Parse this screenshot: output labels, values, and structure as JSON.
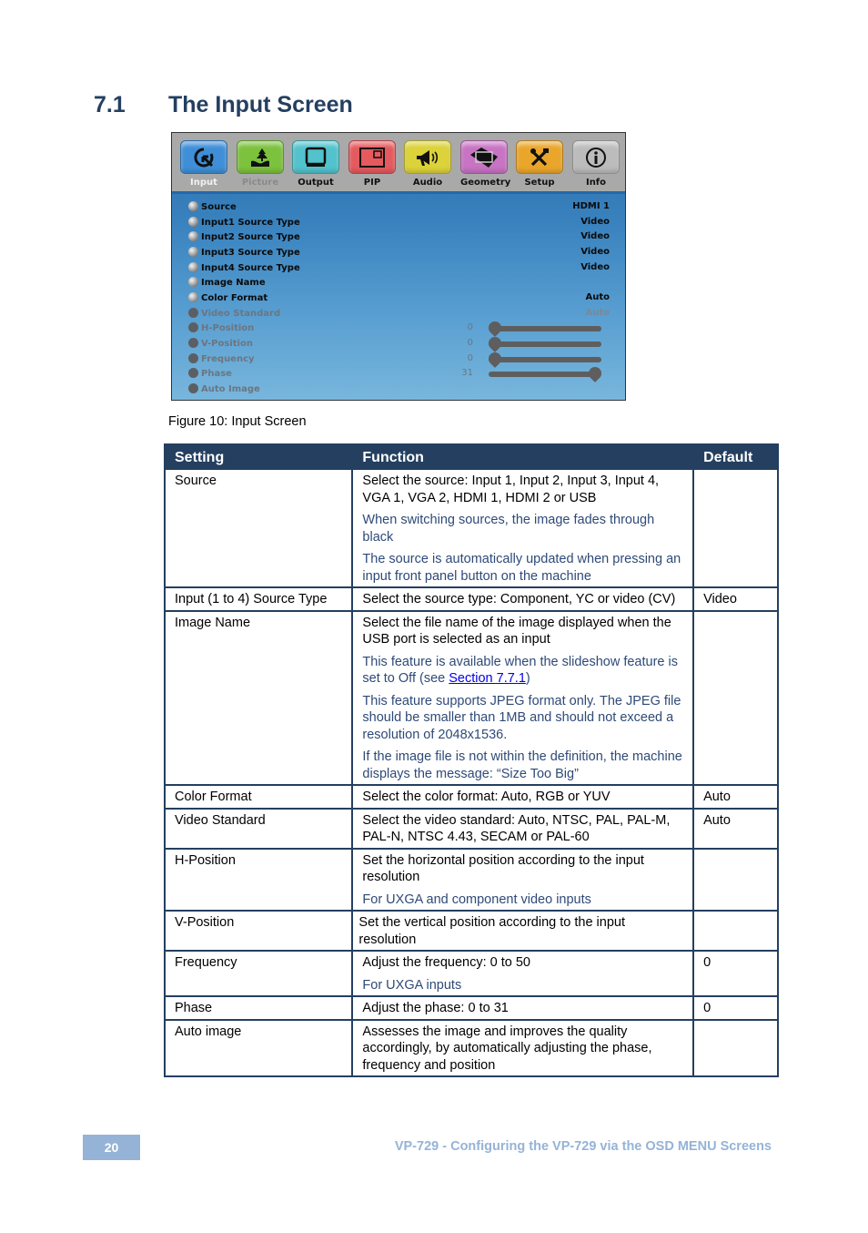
{
  "section": {
    "number": "7.1",
    "title": "The Input Screen"
  },
  "osd": {
    "tabs": [
      {
        "label": "Input",
        "icon": "input-cursor-icon",
        "color": "#3f8fd8",
        "state": "active"
      },
      {
        "label": "Picture",
        "icon": "picture-landscape-icon",
        "color": "#7cc23d",
        "state": "dim"
      },
      {
        "label": "Output",
        "icon": "output-monitor-icon",
        "color": "#52c3cc",
        "state": "normal"
      },
      {
        "label": "PIP",
        "icon": "pip-window-icon",
        "color": "#e55a5e",
        "state": "normal"
      },
      {
        "label": "Audio",
        "icon": "audio-speaker-icon",
        "color": "#dcd23a",
        "state": "normal"
      },
      {
        "label": "Geometry",
        "icon": "geometry-rectangle-icon",
        "color": "#c873c4",
        "state": "normal"
      },
      {
        "label": "Setup",
        "icon": "setup-tools-icon",
        "color": "#eaa62b",
        "state": "normal"
      },
      {
        "label": "Info",
        "icon": "info-icon",
        "color": "#bcbcbc",
        "state": "normal"
      }
    ],
    "items": [
      {
        "label": "Source",
        "value": "HDMI 1",
        "enabled": true
      },
      {
        "label": "Input1 Source Type",
        "value": "Video",
        "enabled": true
      },
      {
        "label": "Input2 Source Type",
        "value": "Video",
        "enabled": true
      },
      {
        "label": "Input3 Source Type",
        "value": "Video",
        "enabled": true
      },
      {
        "label": "Input4 Source Type",
        "value": "Video",
        "enabled": true
      },
      {
        "label": "Image Name",
        "value": "",
        "enabled": true
      },
      {
        "label": "Color Format",
        "value": "Auto",
        "enabled": true
      },
      {
        "label": "Video Standard",
        "value": "Auto",
        "enabled": false
      },
      {
        "label": "H-Position",
        "value": "0",
        "enabled": false,
        "slider": {
          "value": 0,
          "min": 0,
          "max": 31
        }
      },
      {
        "label": "V-Position",
        "value": "0",
        "enabled": false,
        "slider": {
          "value": 0,
          "min": 0,
          "max": 31
        }
      },
      {
        "label": "Frequency",
        "value": "0",
        "enabled": false,
        "slider": {
          "value": 0,
          "min": 0,
          "max": 31
        }
      },
      {
        "label": "Phase",
        "value": "31",
        "enabled": false,
        "slider": {
          "value": 31,
          "min": 0,
          "max": 31
        }
      },
      {
        "label": "Auto Image",
        "value": "",
        "enabled": false
      }
    ]
  },
  "caption": "Figure 10: Input Screen",
  "table": {
    "headers": [
      "Setting",
      "Function",
      "Default"
    ],
    "rows": [
      {
        "setting": "Source",
        "function": "Select the source: Input 1, Input 2, Input 3, Input 4, VGA 1, VGA 2, HDMI 1, HDMI 2 or USB",
        "notes": [
          "When switching sources, the image fades through black",
          "The source is automatically updated when pressing an input front panel button on the machine"
        ],
        "default": ""
      },
      {
        "setting": "Input (1 to 4) Source Type",
        "function": "Select the source type: Component, YC or video (CV)",
        "notes": [],
        "default": "Video"
      },
      {
        "setting": "Image Name",
        "function": "Select the file name of the image displayed when the USB port is selected as an input",
        "notes": [
          "This feature is available when the slideshow feature is set to Off (see ",
          "This feature supports JPEG format only. The JPEG file should be smaller than 1MB and should not exceed a resolution of 2048x1536.",
          "If the image file is not within the definition, the machine displays the message: “Size Too Big”"
        ],
        "link": {
          "text": "Section 7.7.1",
          "after": ")"
        },
        "default": ""
      },
      {
        "setting": "Color Format",
        "function": "Select the color format: Auto, RGB or YUV",
        "notes": [],
        "default": "Auto"
      },
      {
        "setting": "Video Standard",
        "function": "Select the video standard: Auto, NTSC, PAL, PAL-M, PAL-N, NTSC 4.43, SECAM or PAL-60",
        "notes": [],
        "default": "Auto"
      },
      {
        "setting": "H-Position",
        "function": "Set the horizontal position according to the input resolution",
        "notes": [
          "For UXGA and component video inputs"
        ],
        "default": ""
      },
      {
        "setting": "V-Position",
        "function": "Set the vertical position according to the input resolution",
        "notes": [],
        "default": ""
      },
      {
        "setting": "Frequency",
        "function": "Adjust the frequency: 0 to 50",
        "notes": [
          "For UXGA inputs"
        ],
        "default": "0"
      },
      {
        "setting": "Phase",
        "function": "Adjust the phase: 0 to 31",
        "notes": [],
        "default": "0"
      },
      {
        "setting": "Auto image",
        "function": "Assesses the image and improves the quality accordingly, by automatically adjusting the phase, frequency and position",
        "notes": [],
        "default": ""
      }
    ]
  },
  "footer": {
    "page_number": "20",
    "text": "VP-729 - Configuring the VP-729 via the OSD MENU Screens"
  },
  "colors": {
    "heading": "#243f60",
    "note_text": "#2e4a78",
    "footer": "#95b3d7",
    "link": "#0000ee"
  }
}
